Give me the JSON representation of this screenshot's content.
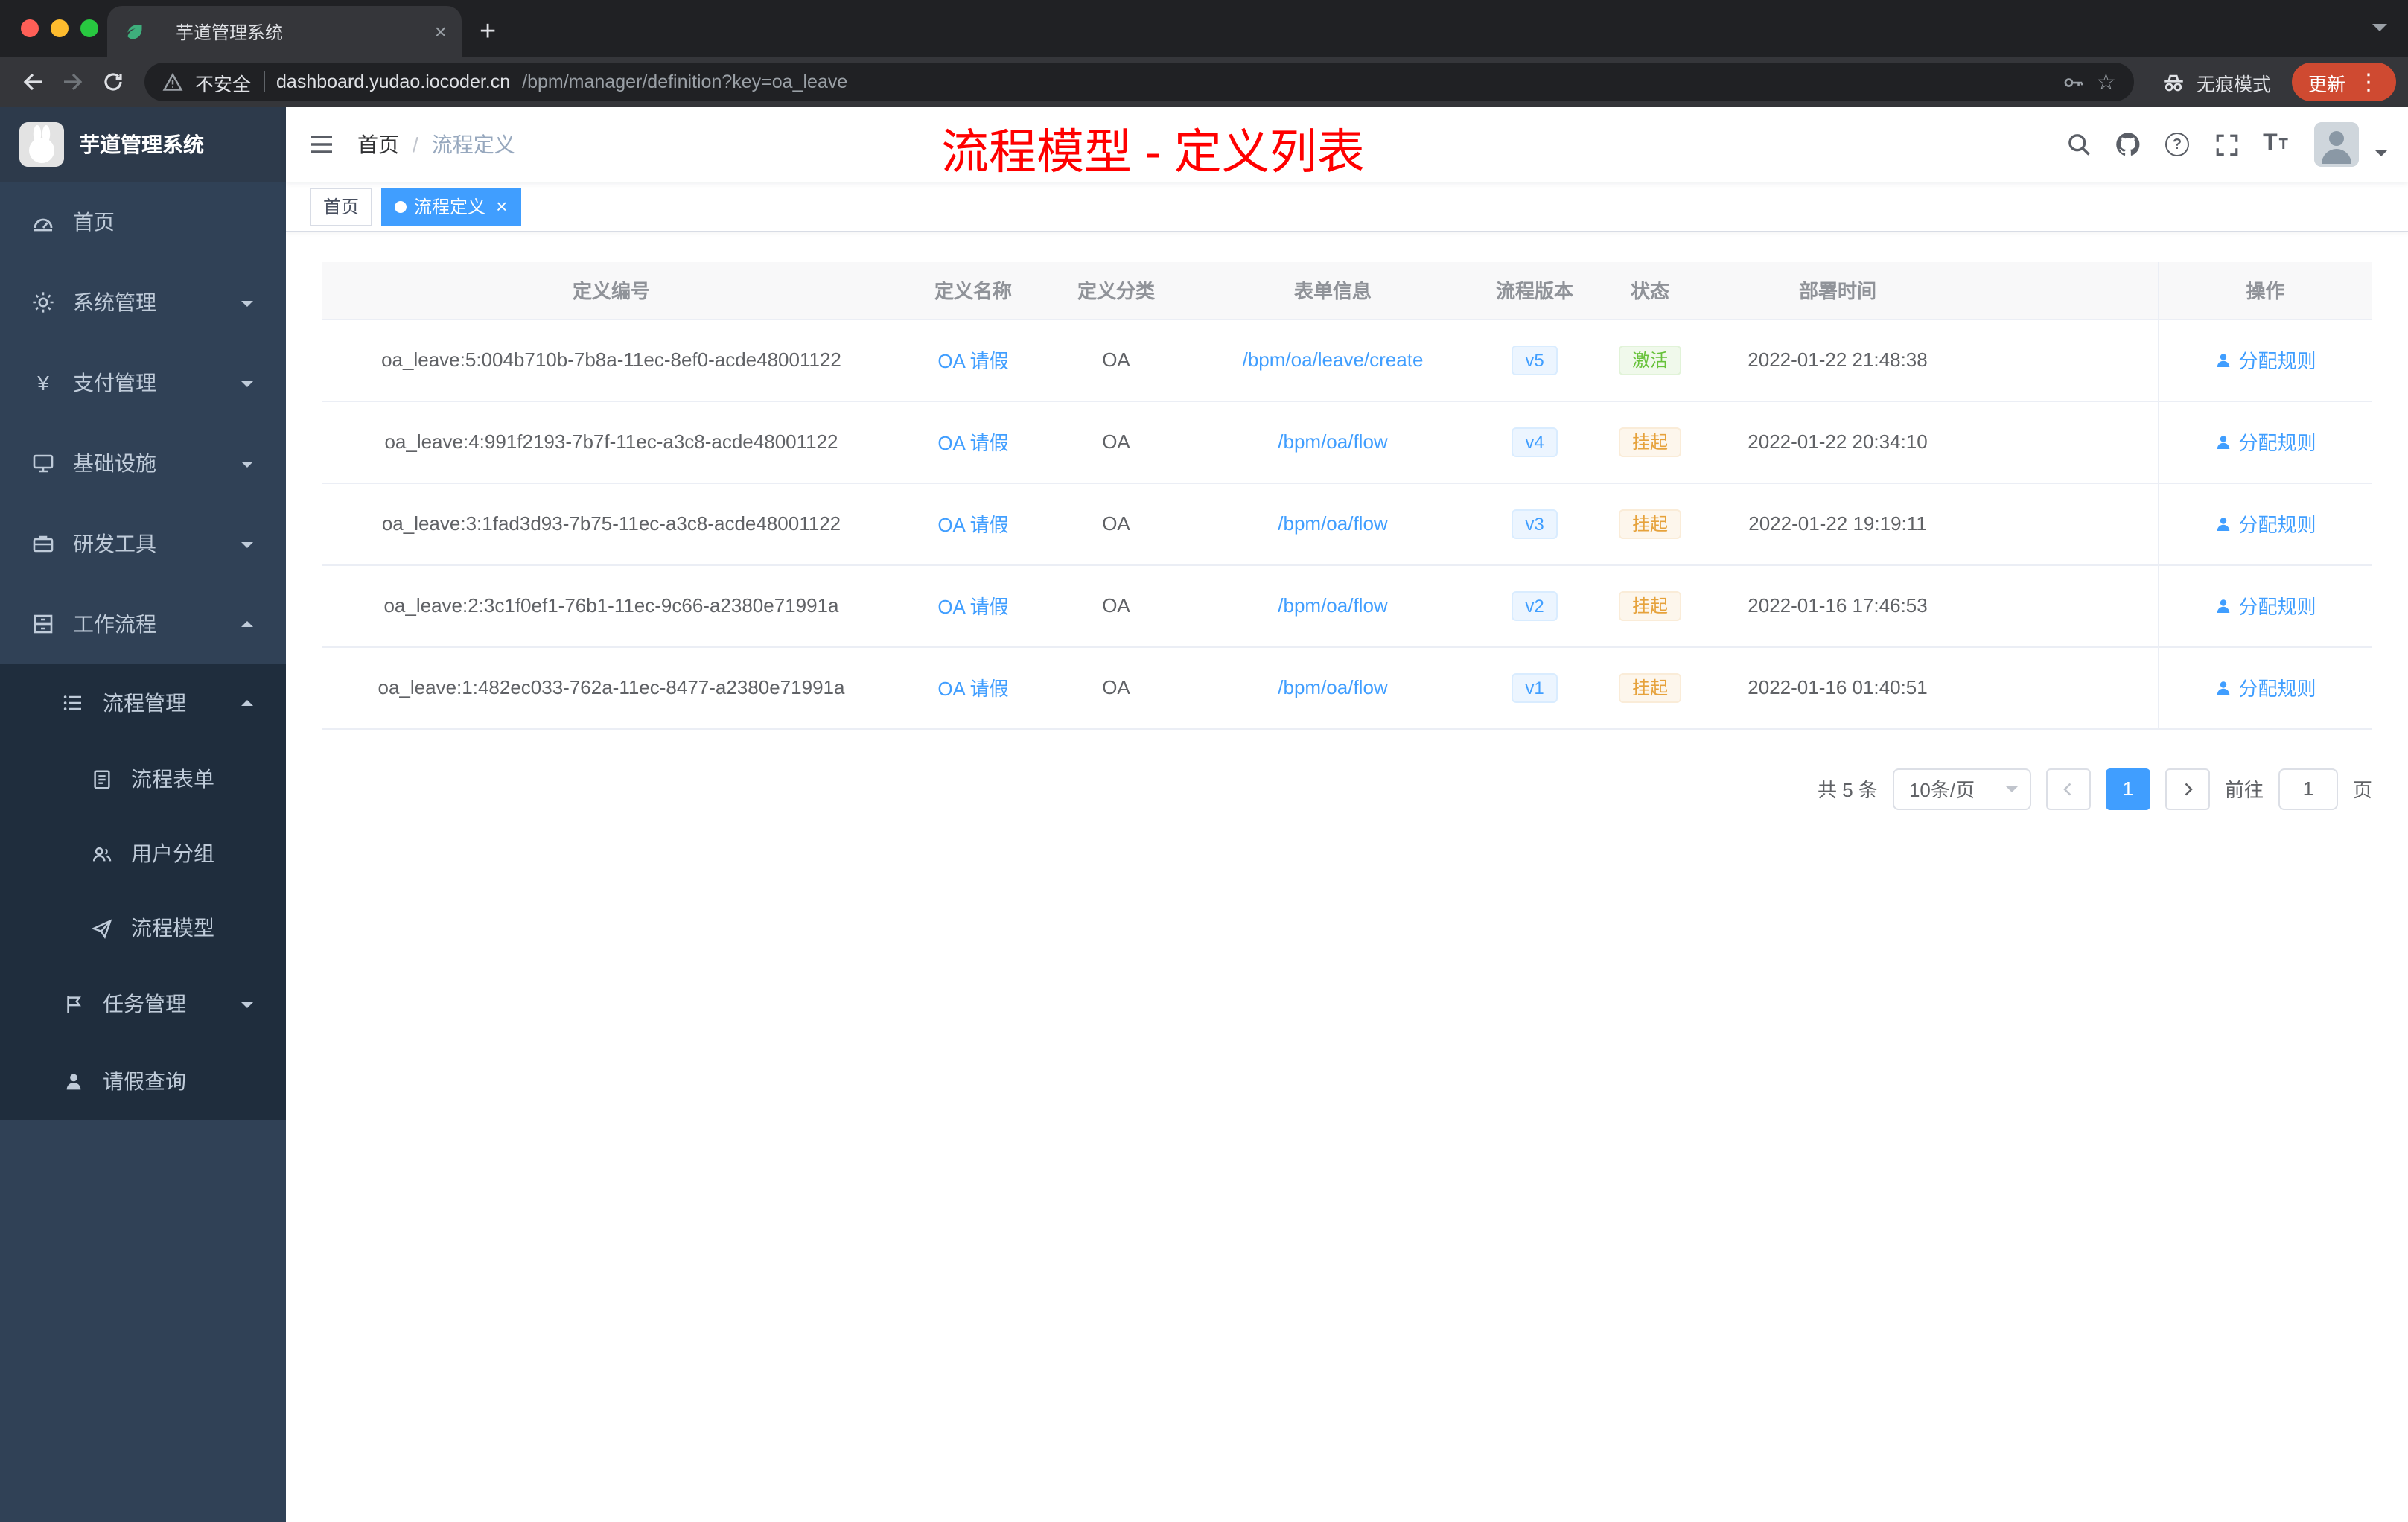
{
  "browser": {
    "tab_title": "芋道管理系统",
    "security_label": "不安全",
    "url_domain": "dashboard.yudao.iocoder.cn",
    "url_path": "/bpm/manager/definition?key=oa_leave",
    "incognito_label": "无痕模式",
    "update_label": "更新"
  },
  "icons": {
    "close": "×",
    "plus": "+",
    "star": "☆",
    "menu_dots": "⋮",
    "yen": "¥",
    "question": "?",
    "t_big": "T",
    "t_small": "T"
  },
  "sidebar": {
    "logo_title": "芋道管理系统",
    "items": [
      {
        "label": "首页"
      },
      {
        "label": "系统管理"
      },
      {
        "label": "支付管理"
      },
      {
        "label": "基础设施"
      },
      {
        "label": "研发工具"
      },
      {
        "label": "工作流程"
      },
      {
        "label": "流程管理"
      },
      {
        "label": "流程表单"
      },
      {
        "label": "用户分组"
      },
      {
        "label": "流程模型"
      },
      {
        "label": "任务管理"
      },
      {
        "label": "请假查询"
      }
    ]
  },
  "header": {
    "breadcrumb": [
      "首页",
      "流程定义"
    ],
    "breadcrumb_separator": "/",
    "annotation": "流程模型 - 定义列表"
  },
  "tags": [
    {
      "label": "首页"
    },
    {
      "label": "流程定义"
    }
  ],
  "table": {
    "columns": [
      "定义编号",
      "定义名称",
      "定义分类",
      "表单信息",
      "流程版本",
      "状态",
      "部署时间",
      "操作"
    ],
    "rows": [
      {
        "id": "oa_leave:5:004b710b-7b8a-11ec-8ef0-acde48001122",
        "name": "OA 请假",
        "category": "OA",
        "form": "/bpm/oa/leave/create",
        "version": "v5",
        "status": "激活",
        "time": "2022-01-22 21:48:38",
        "action": "分配规则"
      },
      {
        "id": "oa_leave:4:991f2193-7b7f-11ec-a3c8-acde48001122",
        "name": "OA 请假",
        "category": "OA",
        "form": "/bpm/oa/flow",
        "version": "v4",
        "status": "挂起",
        "time": "2022-01-22 20:34:10",
        "action": "分配规则"
      },
      {
        "id": "oa_leave:3:1fad3d93-7b75-11ec-a3c8-acde48001122",
        "name": "OA 请假",
        "category": "OA",
        "form": "/bpm/oa/flow",
        "version": "v3",
        "status": "挂起",
        "time": "2022-01-22 19:19:11",
        "action": "分配规则"
      },
      {
        "id": "oa_leave:2:3c1f0ef1-76b1-11ec-9c66-a2380e71991a",
        "name": "OA 请假",
        "category": "OA",
        "form": "/bpm/oa/flow",
        "version": "v2",
        "status": "挂起",
        "time": "2022-01-16 17:46:53",
        "action": "分配规则"
      },
      {
        "id": "oa_leave:1:482ec033-762a-11ec-8477-a2380e71991a",
        "name": "OA 请假",
        "category": "OA",
        "form": "/bpm/oa/flow",
        "version": "v1",
        "status": "挂起",
        "time": "2022-01-16 01:40:51",
        "action": "分配规则"
      }
    ]
  },
  "pagination": {
    "total": "共 5 条",
    "page_size": "10条/页",
    "current_page": "1",
    "goto_label": "前往",
    "goto_value": "1",
    "page_unit": "页"
  },
  "colors": {
    "primary": "#409eff",
    "success": "#67c23a",
    "warning": "#e6a23c",
    "annotation": "#ff0000",
    "sidebar_bg": "#304156",
    "sidebar_sub_bg": "#1f2d3d"
  }
}
